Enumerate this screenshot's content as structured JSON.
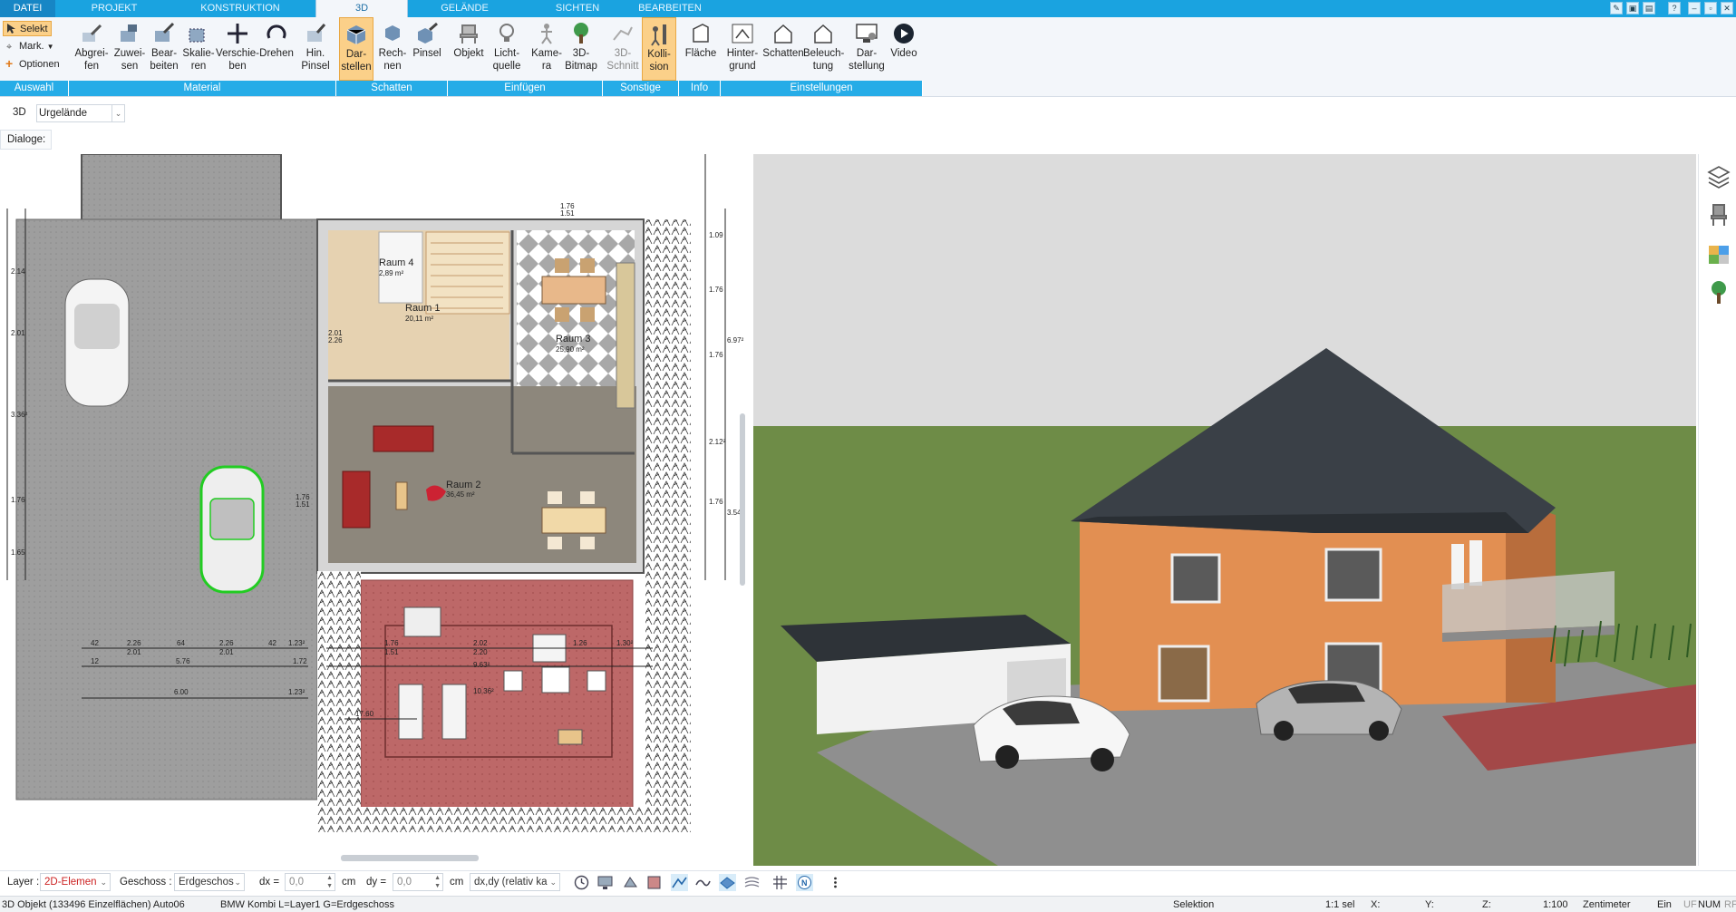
{
  "menu": {
    "tabs": [
      "DATEI",
      "PROJEKT",
      "KONSTRUKTION",
      "3D",
      "GELÄNDE",
      "SICHTEN",
      "BEARBEITEN"
    ],
    "active": "3D"
  },
  "ribbon": {
    "select": {
      "selekt": "Selekt",
      "mark": "Mark.",
      "optionen": "Optionen"
    },
    "buttons": {
      "abgreifen": "Abgrei-\nfen",
      "zuweisen": "Zuwei-\nsen",
      "bearbeiten": "Bear-\nbeiten",
      "skalieren": "Skalie-\nren",
      "verschieben": "Verschie-\nben",
      "drehen": "Drehen",
      "hinpinsel": "Hin.\nPinsel",
      "darstellen": "Dar-\nstellen",
      "rechnen": "Rech-\nnen",
      "pinsel": "Pinsel",
      "objekt": "Objekt",
      "lichtquelle": "Licht-\nquelle",
      "kamera": "Kame-\nra",
      "bitmap3d": "3D-\nBitmap",
      "schnitt3d": "3D-\nSchnitt",
      "kollision": "Kolli-\nsion",
      "flaeche": "Fläche",
      "hintergrund": "Hinter-\ngrund",
      "schatten": "Schatten",
      "beleuchtung": "Beleuch-\ntung",
      "darstellung": "Dar-\nstellung",
      "video": "Video"
    },
    "groups": {
      "auswahl": "Auswahl",
      "material": "Material",
      "schatten": "Schatten",
      "einfuegen": "Einfügen",
      "sonstige": "Sonstige",
      "info": "Info",
      "einstellungen": "Einstellungen"
    }
  },
  "toolbar": {
    "view_tag": "3D",
    "terrain_value": "Urgelände",
    "dialoge": "Dialoge:"
  },
  "plan": {
    "rooms": [
      {
        "name": "Raum 4",
        "area": "2,89 m²"
      },
      {
        "name": "Raum 1",
        "area": "20,11 m²"
      },
      {
        "name": "Raum 3",
        "area": "25,90 m²"
      },
      {
        "name": "Raum 2",
        "area": "36,45 m²"
      }
    ],
    "dims_right": [
      "1.76",
      "1.51",
      "1.09",
      "1.76",
      "1.51",
      "1.42²",
      "1.76",
      "1.51",
      "2.12²",
      "1.76",
      "1.51",
      "3.54²",
      "6.97²"
    ],
    "dims_left": [
      "2.14",
      "2.01",
      "2.01",
      "3.36²",
      "1.76",
      "1.51",
      "1.65"
    ],
    "dims_terrace": [
      "1.76",
      "1.51",
      "2.02",
      "2.20",
      "1.26",
      "1.30²",
      "9.63²",
      "10.36²",
      "17.60"
    ],
    "dims_bottom": [
      "42",
      "2.26",
      "2.01",
      "64",
      "2.26",
      "2.01",
      "42",
      "1.23²",
      "12",
      "5.76",
      "1.72",
      "6.00",
      "1.23²"
    ],
    "door_labels": [
      "2.01",
      "2.26",
      "1.76",
      "1.51",
      "1.76",
      "1.51"
    ],
    "stair_label": "17 St\n18,5 / 30,7"
  },
  "bottom": {
    "layer_label": "Layer :",
    "layer_value": "2D-Elemen",
    "geschoss_label": "Geschoss :",
    "geschoss_value": "Erdgeschos",
    "dx_label": "dx =",
    "dx_value": "0,0",
    "dx_unit": "cm",
    "dy_label": "dy =",
    "dy_value": "0,0",
    "dy_unit": "cm",
    "rel_value": "dx,dy (relativ ka"
  },
  "status": {
    "object": "3D Objekt (133496 Einzelflächen) Auto06",
    "info": "BMW Kombi L=Layer1 G=Erdgeschoss",
    "mode": "Selektion",
    "sel": "1:1 sel",
    "x": "X:",
    "y": "Y:",
    "z": "Z:",
    "scale": "1:100",
    "unit": "Zentimeter",
    "ein": "Ein",
    "uf": "UF",
    "num": "NUM",
    "rf": "RF"
  },
  "colors": {
    "menubar": "#1aa3e0",
    "ribbon_group": "#26ace7",
    "active_button": "#fbd089",
    "house_wall": "#e28f52",
    "roof": "#3a4047",
    "lawn": "#6e8c47",
    "paving": "#8c8c8c",
    "terrace": "#b66363",
    "car_highlight": "#22cc22"
  }
}
